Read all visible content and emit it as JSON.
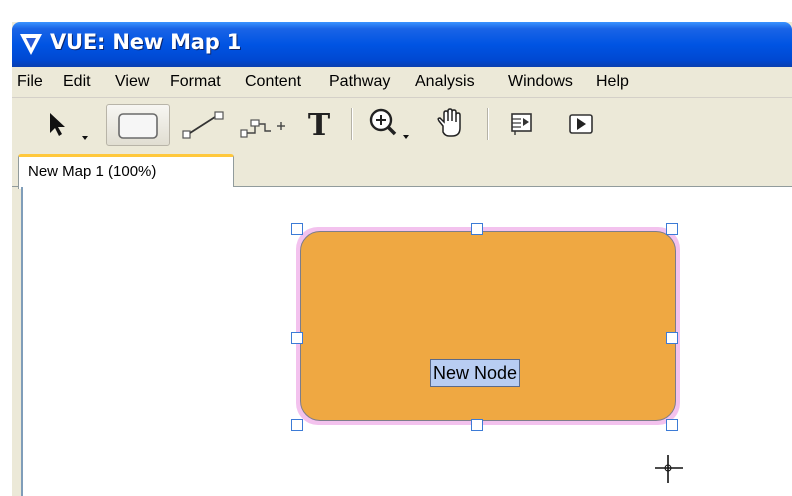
{
  "window": {
    "title": "VUE: New Map 1",
    "app_icon": "vue-logo-icon"
  },
  "menu": {
    "items": [
      "File",
      "Edit",
      "View",
      "Format",
      "Content",
      "Pathway",
      "Analysis",
      "Windows",
      "Help"
    ]
  },
  "toolbar": {
    "tools": [
      {
        "name": "selection-arrow-icon",
        "has_dropdown": true,
        "selected": false
      },
      {
        "name": "node-rectangle-icon",
        "selected": true
      },
      {
        "name": "link-connector-icon",
        "selected": false
      },
      {
        "name": "curved-link-icon",
        "selected": false
      },
      {
        "name": "text-tool-icon",
        "selected": false
      },
      {
        "name": "zoom-icon",
        "has_dropdown": true,
        "selected": false
      },
      {
        "name": "hand-pan-icon",
        "selected": false
      },
      {
        "name": "presentation-slides-icon",
        "selected": false
      },
      {
        "name": "play-icon",
        "selected": false
      }
    ]
  },
  "tabs": [
    {
      "label": "New Map 1 (100%)",
      "active": true
    }
  ],
  "map": {
    "node": {
      "label": "New Node",
      "fill_color": "#efa842",
      "selection_color": "#f3c2ee",
      "label_highlight": "#b8cdf2",
      "handle_color": "#3c7bd6"
    },
    "cursor": "crosshair-icon"
  },
  "colors": {
    "titlebar": "#0054e3",
    "chrome": "#ece9d8",
    "tab_accent": "#ffc83c"
  }
}
